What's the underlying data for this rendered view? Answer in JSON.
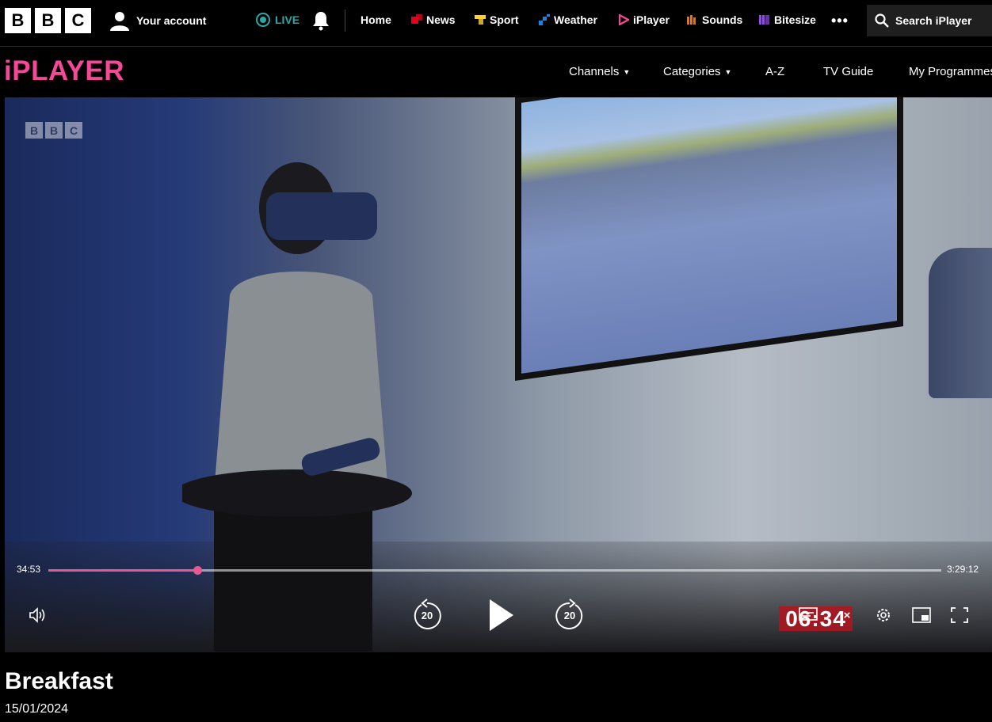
{
  "global_nav": {
    "bbc_letters": [
      "B",
      "B",
      "C"
    ],
    "account_label": "Your account",
    "live_label": "LIVE",
    "items": [
      {
        "label": "Home",
        "icon": "none"
      },
      {
        "label": "News",
        "icon": "news-icon",
        "color": "#e3001b"
      },
      {
        "label": "Sport",
        "icon": "sport-icon",
        "color": "#ffd230"
      },
      {
        "label": "Weather",
        "icon": "weather-icon",
        "color": "#1b82e6"
      },
      {
        "label": "iPlayer",
        "icon": "iplayer-icon",
        "color": "#f54997"
      },
      {
        "label": "Sounds",
        "icon": "sounds-icon",
        "color": "#ff6a00"
      },
      {
        "label": "Bitesize",
        "icon": "bitesize-icon",
        "color": "#8d4fd8"
      }
    ],
    "more_label": "•••",
    "search_label": "Search iPlayer"
  },
  "iplayer_nav": {
    "logo": "iPLAYER",
    "items": [
      {
        "label": "Channels",
        "dropdown": true
      },
      {
        "label": "Categories",
        "dropdown": true
      },
      {
        "label": "A-Z",
        "dropdown": false
      },
      {
        "label": "TV Guide",
        "dropdown": false
      },
      {
        "label": "My Programmes",
        "dropdown": false
      }
    ]
  },
  "player": {
    "watermark": [
      "B",
      "B",
      "C"
    ],
    "current_time": "34:53",
    "duration": "3:29:12",
    "progress_fraction": 0.1667,
    "skip_back_seconds": "20",
    "skip_forward_seconds": "20",
    "overlay_clock": "06:34",
    "accent_color": "#e55a92"
  },
  "programme": {
    "title": "Breakfast",
    "date": "15/01/2024"
  }
}
